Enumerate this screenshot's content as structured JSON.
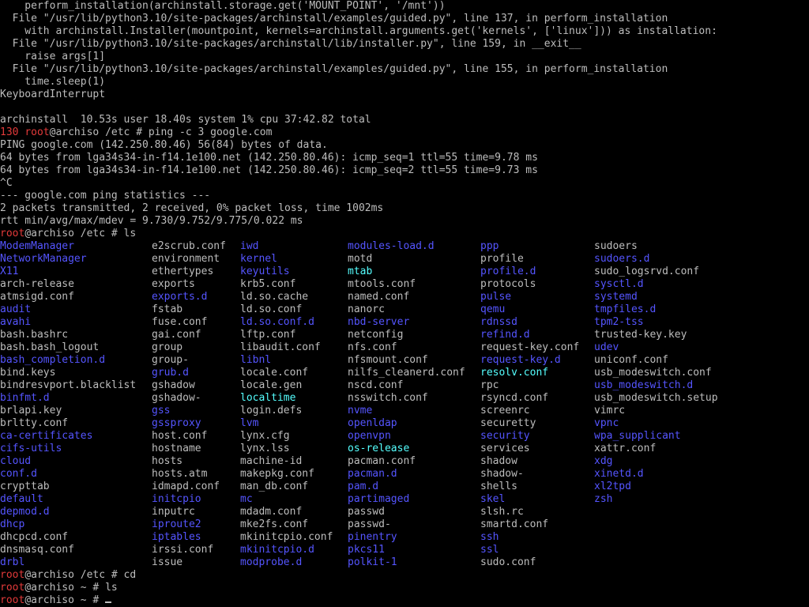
{
  "trace_lines": [
    "    perform_installation(archinstall.storage.get('MOUNT_POINT', '/mnt'))",
    "  File \"/usr/lib/python3.10/site-packages/archinstall/examples/guided.py\", line 137, in perform_installation",
    "    with archinstall.Installer(mountpoint, kernels=archinstall.arguments.get('kernels', ['linux'])) as installation:",
    "  File \"/usr/lib/python3.10/site-packages/archinstall/lib/installer.py\", line 159, in __exit__",
    "    raise args[1]",
    "  File \"/usr/lib/python3.10/site-packages/archinstall/examples/guided.py\", line 155, in perform_installation",
    "    time.sleep(1)",
    "KeyboardInterrupt",
    "",
    "archinstall  10.53s user 18.40s system 1% cpu 37:42.82 total"
  ],
  "ping_prompt": {
    "exit_code": "130",
    "user": "root",
    "host_dir": "@archiso /etc # ",
    "command": "ping -c 3 google.com"
  },
  "ping_output": [
    "PING google.com (142.250.80.46) 56(84) bytes of data.",
    "64 bytes from lga34s34-in-f14.1e100.net (142.250.80.46): icmp_seq=1 ttl=55 time=9.78 ms",
    "64 bytes from lga34s34-in-f14.1e100.net (142.250.80.46): icmp_seq=2 ttl=55 time=9.73 ms",
    "^C",
    "--- google.com ping statistics ---",
    "2 packets transmitted, 2 received, 0% packet loss, time 1002ms",
    "rtt min/avg/max/mdev = 9.730/9.752/9.775/0.022 ms"
  ],
  "ls_prompt": {
    "user": "root",
    "host_dir": "@archiso /etc # ",
    "command": "ls"
  },
  "ls_rows": [
    [
      {
        "n": "ModemManager",
        "t": "dir"
      },
      {
        "n": "e2scrub.conf",
        "t": "file"
      },
      {
        "n": "iwd",
        "t": "dir"
      },
      {
        "n": "modules-load.d",
        "t": "dir"
      },
      {
        "n": "ppp",
        "t": "dir"
      },
      {
        "n": "sudoers",
        "t": "file"
      }
    ],
    [
      {
        "n": "NetworkManager",
        "t": "dir"
      },
      {
        "n": "environment",
        "t": "file"
      },
      {
        "n": "kernel",
        "t": "dir"
      },
      {
        "n": "motd",
        "t": "file"
      },
      {
        "n": "profile",
        "t": "file"
      },
      {
        "n": "sudoers.d",
        "t": "dir"
      }
    ],
    [
      {
        "n": "X11",
        "t": "dir"
      },
      {
        "n": "ethertypes",
        "t": "file"
      },
      {
        "n": "keyutils",
        "t": "dir"
      },
      {
        "n": "mtab",
        "t": "link"
      },
      {
        "n": "profile.d",
        "t": "dir"
      },
      {
        "n": "sudo_logsrvd.conf",
        "t": "file"
      }
    ],
    [
      {
        "n": "arch-release",
        "t": "file"
      },
      {
        "n": "exports",
        "t": "file"
      },
      {
        "n": "krb5.conf",
        "t": "file"
      },
      {
        "n": "mtools.conf",
        "t": "file"
      },
      {
        "n": "protocols",
        "t": "file"
      },
      {
        "n": "sysctl.d",
        "t": "dir"
      }
    ],
    [
      {
        "n": "atmsigd.conf",
        "t": "file"
      },
      {
        "n": "exports.d",
        "t": "dir"
      },
      {
        "n": "ld.so.cache",
        "t": "file"
      },
      {
        "n": "named.conf",
        "t": "file"
      },
      {
        "n": "pulse",
        "t": "dir"
      },
      {
        "n": "systemd",
        "t": "dir"
      }
    ],
    [
      {
        "n": "audit",
        "t": "dir"
      },
      {
        "n": "fstab",
        "t": "file"
      },
      {
        "n": "ld.so.conf",
        "t": "file"
      },
      {
        "n": "nanorc",
        "t": "file"
      },
      {
        "n": "qemu",
        "t": "dir"
      },
      {
        "n": "tmpfiles.d",
        "t": "dir"
      }
    ],
    [
      {
        "n": "avahi",
        "t": "dir"
      },
      {
        "n": "fuse.conf",
        "t": "file"
      },
      {
        "n": "ld.so.conf.d",
        "t": "dir"
      },
      {
        "n": "nbd-server",
        "t": "dir"
      },
      {
        "n": "rdnssd",
        "t": "dir"
      },
      {
        "n": "tpm2-tss",
        "t": "dir"
      }
    ],
    [
      {
        "n": "bash.bashrc",
        "t": "file"
      },
      {
        "n": "gai.conf",
        "t": "file"
      },
      {
        "n": "lftp.conf",
        "t": "file"
      },
      {
        "n": "netconfig",
        "t": "file"
      },
      {
        "n": "refind.d",
        "t": "dir"
      },
      {
        "n": "trusted-key.key",
        "t": "file"
      }
    ],
    [
      {
        "n": "bash.bash_logout",
        "t": "file"
      },
      {
        "n": "group",
        "t": "file"
      },
      {
        "n": "libaudit.conf",
        "t": "file"
      },
      {
        "n": "nfs.conf",
        "t": "file"
      },
      {
        "n": "request-key.conf",
        "t": "file"
      },
      {
        "n": "udev",
        "t": "dir"
      }
    ],
    [
      {
        "n": "bash_completion.d",
        "t": "dir"
      },
      {
        "n": "group-",
        "t": "file"
      },
      {
        "n": "libnl",
        "t": "dir"
      },
      {
        "n": "nfsmount.conf",
        "t": "file"
      },
      {
        "n": "request-key.d",
        "t": "dir"
      },
      {
        "n": "uniconf.conf",
        "t": "file"
      }
    ],
    [
      {
        "n": "bind.keys",
        "t": "file"
      },
      {
        "n": "grub.d",
        "t": "dir"
      },
      {
        "n": "locale.conf",
        "t": "file"
      },
      {
        "n": "nilfs_cleanerd.conf",
        "t": "file"
      },
      {
        "n": "resolv.conf",
        "t": "link"
      },
      {
        "n": "usb_modeswitch.conf",
        "t": "file"
      }
    ],
    [
      {
        "n": "bindresvport.blacklist",
        "t": "file"
      },
      {
        "n": "gshadow",
        "t": "file"
      },
      {
        "n": "locale.gen",
        "t": "file"
      },
      {
        "n": "nscd.conf",
        "t": "file"
      },
      {
        "n": "rpc",
        "t": "file"
      },
      {
        "n": "usb_modeswitch.d",
        "t": "dir"
      }
    ],
    [
      {
        "n": "binfmt.d",
        "t": "dir"
      },
      {
        "n": "gshadow-",
        "t": "file"
      },
      {
        "n": "localtime",
        "t": "link"
      },
      {
        "n": "nsswitch.conf",
        "t": "file"
      },
      {
        "n": "rsyncd.conf",
        "t": "file"
      },
      {
        "n": "usb_modeswitch.setup",
        "t": "file"
      }
    ],
    [
      {
        "n": "brlapi.key",
        "t": "file"
      },
      {
        "n": "gss",
        "t": "dir"
      },
      {
        "n": "login.defs",
        "t": "file"
      },
      {
        "n": "nvme",
        "t": "dir"
      },
      {
        "n": "screenrc",
        "t": "file"
      },
      {
        "n": "vimrc",
        "t": "file"
      }
    ],
    [
      {
        "n": "brltty.conf",
        "t": "file"
      },
      {
        "n": "gssproxy",
        "t": "dir"
      },
      {
        "n": "lvm",
        "t": "dir"
      },
      {
        "n": "openldap",
        "t": "dir"
      },
      {
        "n": "securetty",
        "t": "file"
      },
      {
        "n": "vpnc",
        "t": "dir"
      }
    ],
    [
      {
        "n": "ca-certificates",
        "t": "dir"
      },
      {
        "n": "host.conf",
        "t": "file"
      },
      {
        "n": "lynx.cfg",
        "t": "file"
      },
      {
        "n": "openvpn",
        "t": "dir"
      },
      {
        "n": "security",
        "t": "dir"
      },
      {
        "n": "wpa_supplicant",
        "t": "dir"
      }
    ],
    [
      {
        "n": "cifs-utils",
        "t": "dir"
      },
      {
        "n": "hostname",
        "t": "file"
      },
      {
        "n": "lynx.lss",
        "t": "file"
      },
      {
        "n": "os-release",
        "t": "link"
      },
      {
        "n": "services",
        "t": "file"
      },
      {
        "n": "xattr.conf",
        "t": "file"
      }
    ],
    [
      {
        "n": "cloud",
        "t": "dir"
      },
      {
        "n": "hosts",
        "t": "file"
      },
      {
        "n": "machine-id",
        "t": "file"
      },
      {
        "n": "pacman.conf",
        "t": "file"
      },
      {
        "n": "shadow",
        "t": "file"
      },
      {
        "n": "xdg",
        "t": "dir"
      }
    ],
    [
      {
        "n": "conf.d",
        "t": "dir"
      },
      {
        "n": "hosts.atm",
        "t": "file"
      },
      {
        "n": "makepkg.conf",
        "t": "file"
      },
      {
        "n": "pacman.d",
        "t": "dir"
      },
      {
        "n": "shadow-",
        "t": "file"
      },
      {
        "n": "xinetd.d",
        "t": "dir"
      }
    ],
    [
      {
        "n": "crypttab",
        "t": "file"
      },
      {
        "n": "idmapd.conf",
        "t": "file"
      },
      {
        "n": "man_db.conf",
        "t": "file"
      },
      {
        "n": "pam.d",
        "t": "dir"
      },
      {
        "n": "shells",
        "t": "file"
      },
      {
        "n": "xl2tpd",
        "t": "dir"
      }
    ],
    [
      {
        "n": "default",
        "t": "dir"
      },
      {
        "n": "initcpio",
        "t": "dir"
      },
      {
        "n": "mc",
        "t": "dir"
      },
      {
        "n": "partimaged",
        "t": "dir"
      },
      {
        "n": "skel",
        "t": "dir"
      },
      {
        "n": "zsh",
        "t": "dir"
      }
    ],
    [
      {
        "n": "depmod.d",
        "t": "dir"
      },
      {
        "n": "inputrc",
        "t": "file"
      },
      {
        "n": "mdadm.conf",
        "t": "file"
      },
      {
        "n": "passwd",
        "t": "file"
      },
      {
        "n": "slsh.rc",
        "t": "file"
      },
      {
        "n": "",
        "t": "file"
      }
    ],
    [
      {
        "n": "dhcp",
        "t": "dir"
      },
      {
        "n": "iproute2",
        "t": "dir"
      },
      {
        "n": "mke2fs.conf",
        "t": "file"
      },
      {
        "n": "passwd-",
        "t": "file"
      },
      {
        "n": "smartd.conf",
        "t": "file"
      },
      {
        "n": "",
        "t": "file"
      }
    ],
    [
      {
        "n": "dhcpcd.conf",
        "t": "file"
      },
      {
        "n": "iptables",
        "t": "dir"
      },
      {
        "n": "mkinitcpio.conf",
        "t": "file"
      },
      {
        "n": "pinentry",
        "t": "dir"
      },
      {
        "n": "ssh",
        "t": "dir"
      },
      {
        "n": "",
        "t": "file"
      }
    ],
    [
      {
        "n": "dnsmasq.conf",
        "t": "file"
      },
      {
        "n": "irssi.conf",
        "t": "file"
      },
      {
        "n": "mkinitcpio.d",
        "t": "dir"
      },
      {
        "n": "pkcs11",
        "t": "dir"
      },
      {
        "n": "ssl",
        "t": "dir"
      },
      {
        "n": "",
        "t": "file"
      }
    ],
    [
      {
        "n": "drbl",
        "t": "dir"
      },
      {
        "n": "issue",
        "t": "file"
      },
      {
        "n": "modprobe.d",
        "t": "dir"
      },
      {
        "n": "polkit-1",
        "t": "dir"
      },
      {
        "n": "sudo.conf",
        "t": "file"
      },
      {
        "n": "",
        "t": "file"
      }
    ]
  ],
  "final_prompts": [
    {
      "user": "root",
      "host_dir": "@archiso /etc # ",
      "command": "cd"
    },
    {
      "user": "root",
      "host_dir": "@archiso ~ # ",
      "command": "ls"
    },
    {
      "user": "root",
      "host_dir": "@archiso ~ # ",
      "command": ""
    }
  ],
  "colors": {
    "background": "#000000",
    "foreground": "#bdbdbd",
    "directory": "#5555ff",
    "symlink": "#55ffff",
    "prompt_user": "#e33a3a"
  }
}
